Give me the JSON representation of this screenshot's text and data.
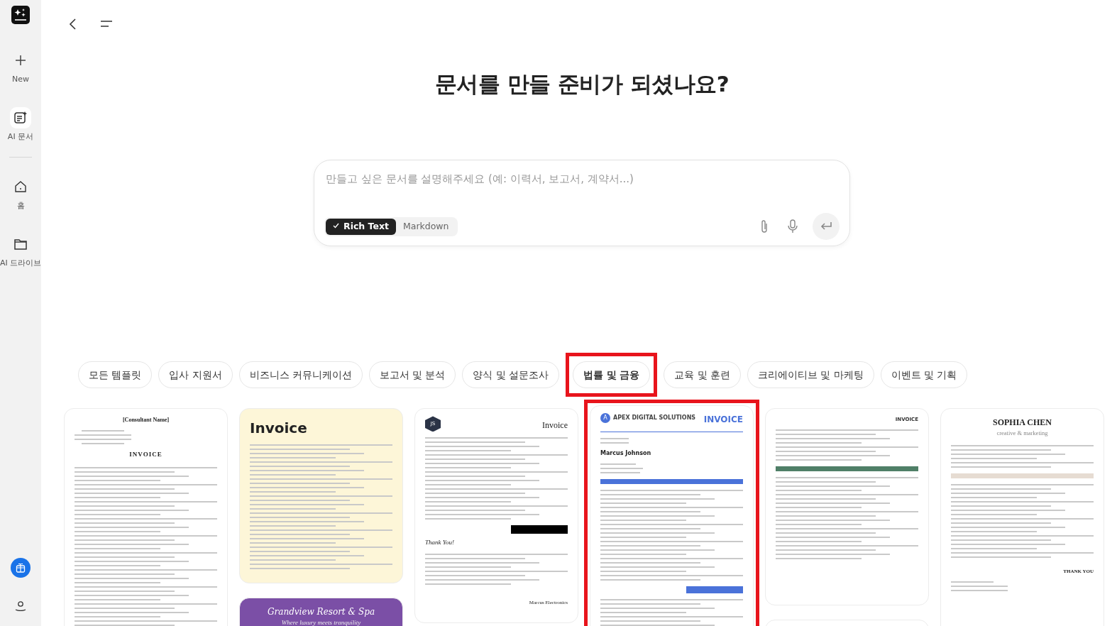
{
  "sidebar": {
    "items": [
      {
        "kind": "new",
        "label": "New",
        "selected": false
      },
      {
        "kind": "doc",
        "label": "AI 문서",
        "selected": true
      },
      {
        "kind": "home",
        "label": "홈",
        "selected": false
      },
      {
        "kind": "drive",
        "label": "AI 드라이브",
        "selected": false
      }
    ]
  },
  "heading": "문서를 만들 준비가 되셨나요?",
  "prompt": {
    "placeholder": "만들고 싶은 문서를 설명해주세요 (예: 이력서, 보고서, 계약서...)",
    "modes": [
      {
        "label": "Rich Text",
        "selected": true
      },
      {
        "label": "Markdown",
        "selected": false
      }
    ]
  },
  "tabs": [
    {
      "label": "모든 템플릿",
      "selected": false,
      "highlighted": false
    },
    {
      "label": "입사 지원서",
      "selected": false,
      "highlighted": false
    },
    {
      "label": "비즈니스 커뮤니케이션",
      "selected": false,
      "highlighted": false
    },
    {
      "label": "보고서 및 분석",
      "selected": false,
      "highlighted": false
    },
    {
      "label": "양식 및 설문조사",
      "selected": false,
      "highlighted": false
    },
    {
      "label": "법률 및 금융",
      "selected": true,
      "highlighted": true
    },
    {
      "label": "교육 및 훈련",
      "selected": false,
      "highlighted": false
    },
    {
      "label": "크리에이티브 및 마케팅",
      "selected": false,
      "highlighted": false
    },
    {
      "label": "이벤트 및 기획",
      "selected": false,
      "highlighted": false
    }
  ],
  "template_columns": [
    [
      {
        "kind": "classic",
        "highlighted": false,
        "texts": [
          "[Consultant Name]",
          "INVOICE"
        ]
      }
    ],
    [
      {
        "kind": "yellow",
        "highlighted": false,
        "texts": [
          "Invoice"
        ]
      },
      {
        "kind": "purple",
        "highlighted": false,
        "texts": [
          "Grandview Resort & Spa",
          "Where luxury meets tranquility"
        ]
      }
    ],
    [
      {
        "kind": "hex",
        "highlighted": false,
        "texts": [
          "JS",
          "Invoice",
          "Thank You!",
          "Marcus Electronics"
        ]
      }
    ],
    [
      {
        "kind": "apex",
        "highlighted": true,
        "texts": [
          "A",
          "APEX DIGITAL SOLUTIONS",
          "INVOICE",
          "Marcus Johnson"
        ]
      }
    ],
    [
      {
        "kind": "green",
        "highlighted": false,
        "texts": [
          "INVOICE"
        ]
      },
      {
        "kind": "blank"
      }
    ],
    [
      {
        "kind": "serif",
        "highlighted": false,
        "texts": [
          "SOPHIA CHEN",
          "creative & marketing",
          "THANK YOU"
        ]
      }
    ]
  ]
}
